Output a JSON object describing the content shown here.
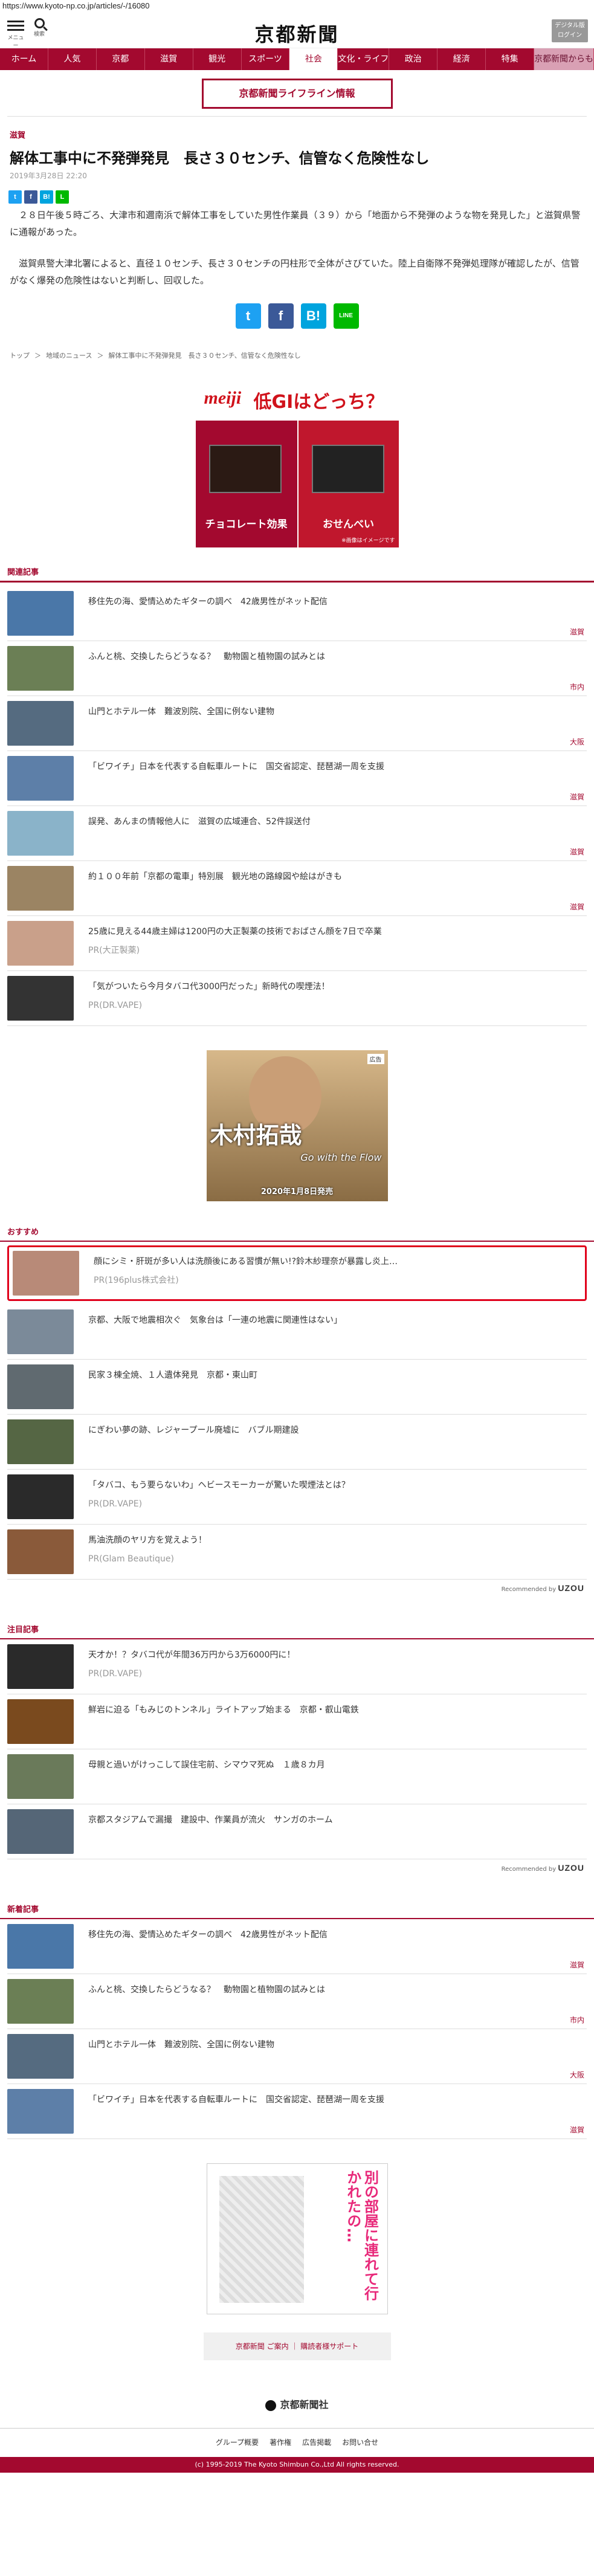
{
  "url": "https://www.kyoto-np.co.jp/articles/-/16080",
  "header": {
    "menu_label": "メニュー",
    "search_label": "検索",
    "logo": "京都新聞",
    "digital_line1": "デジタル版",
    "digital_line2": "ログイン"
  },
  "nav": [
    "ホーム",
    "人気",
    "京都",
    "滋賀",
    "観光",
    "スポーツ",
    "社会",
    "文化・ライフ",
    "政治",
    "経済",
    "特集",
    "京都新聞からも"
  ],
  "lifeline": "京都新聞ライフライン情報",
  "article": {
    "category": "滋賀",
    "title": "解体工事中に不発弾発見　長さ３０センチ、信管なく危険性なし",
    "date": "2019年3月28日 22:20",
    "paragraphs": [
      "２８日午後５時ごろ、大津市和邇南浜で解体工事をしていた男性作業員（３９）から「地面から不発弾のような物を発見した」と滋賀県警に通報があった。",
      "滋賀県警大津北署によると、直径１０センチ、長さ３０センチの円柱形で全体がさびていた。陸上自衛隊不発弾処理隊が確認したが、信管がなく爆発の危険性はないと判断し、回収した。"
    ]
  },
  "share": {
    "twitter": "t",
    "facebook": "f",
    "hatena": "B!",
    "line": "LINE"
  },
  "breadcrumb": [
    "トップ",
    "地域のニュース",
    "解体工事中に不発弾発見　長さ３０センチ、信管なく危険性なし"
  ],
  "ad1": {
    "brand": "meiji",
    "headline": "低GIはどっち？",
    "left_caption": "チョコレート効果",
    "right_caption": "おせんべい",
    "note": "※画像はイメージです"
  },
  "related": {
    "heading": "関連記事",
    "items": [
      {
        "title": "移住先の海、愛情込めたギターの調べ　42歳男性がネット配信",
        "tag": "滋賀",
        "color": "#4a77a8"
      },
      {
        "title": "ふんと桃、交換したらどうなる？　動物園と植物園の試みとは",
        "tag": "市内",
        "color": "#6b7f55"
      },
      {
        "title": "山門とホテル一体　難波別院、全国に例ない建物",
        "tag": "大阪",
        "color": "#556b80"
      },
      {
        "title": "「ビワイチ」日本を代表する自転車ルートに　国交省認定、琵琶湖一周を支援",
        "tag": "滋賀",
        "color": "#5d7fa8"
      },
      {
        "title": "誤発、あんまの情報他人に　滋賀の広域連合、52件誤送付",
        "tag": "滋賀",
        "color": "#8ab3c9"
      },
      {
        "title": "約１００年前「京都の電車」特別展　観光地の路線図や絵はがきも",
        "tag": "滋賀",
        "color": "#9b8463"
      },
      {
        "title": "25歳に見える44歳主婦は1200円の大正製薬の技術でおばさん顔を7日で卒業",
        "pr": "PR(大正製薬)",
        "color": "#c9a08a"
      },
      {
        "title": "「気がついたら今月タバコ代3000円だった」新時代の喫煙法！",
        "pr": "PR(DR.VAPE)",
        "color": "#333333"
      }
    ]
  },
  "ad2": {
    "badge": "広告",
    "name": "木村拓哉",
    "album": "Go with the Flow",
    "release": "2020年1月8日発売"
  },
  "recommend": {
    "heading": "おすすめ",
    "items": [
      {
        "title": "顔にシミ・肝斑が多い人は洗顔後にある習慣が無い!?鈴木紗理奈が暴露し炎上…",
        "pr": "PR(196plus株式会社)",
        "color": "#b88a78",
        "highlight": true
      },
      {
        "title": "京都、大阪で地震相次ぐ　気象台は「一連の地震に関連性はない」",
        "color": "#7b8a99"
      },
      {
        "title": "民家３棟全焼、１人遺体発見　京都・東山町",
        "color": "#606a70"
      },
      {
        "title": "にぎわい夢の跡、レジャープール廃墟に　バブル期建設",
        "color": "#556644"
      },
      {
        "title": "「タバコ、もう要らないわ」ヘビースモーカーが驚いた喫煙法とは？",
        "pr": "PR(DR.VAPE)",
        "color": "#2a2a2a"
      },
      {
        "title": "馬油洗顔のヤリ方を覚えよう！",
        "pr": "PR(Glam Beautique)",
        "color": "#8a5a3a"
      }
    ],
    "recommended_by": "Recommended by",
    "brand": "UZOU"
  },
  "attention": {
    "heading": "注目記事",
    "items": [
      {
        "title": "天才か！？タバコ代が年間36万円から3万6000円に！",
        "pr": "PR(DR.VAPE)",
        "color": "#2a2a2a"
      },
      {
        "title": "鮮岩に迫る「もみじのトンネル」ライトアップ始まる　京都・叡山電鉄",
        "color": "#7a4a1e"
      },
      {
        "title": "母親と過いがけっこして誤住宅前、シマウマ死ぬ　１歳８カ月",
        "color": "#6a7a5a"
      },
      {
        "title": "京都スタジアムで漏撮　建設中、作業員が流火　サンガのホーム",
        "color": "#556677"
      }
    ],
    "recommended_by": "Recommended by",
    "brand": "UZOU"
  },
  "latest": {
    "heading": "新着記事",
    "items": [
      {
        "title": "移住先の海、愛情込めたギターの調べ　42歳男性がネット配信",
        "tag": "滋賀",
        "color": "#4a77a8"
      },
      {
        "title": "ふんと桃、交換したらどうなる？　動物園と植物園の試みとは",
        "tag": "市内",
        "color": "#6b7f55"
      },
      {
        "title": "山門とホテル一体　難波別院、全国に例ない建物",
        "tag": "大阪",
        "color": "#556b80"
      },
      {
        "title": "「ビワイチ」日本を代表する自転車ルートに　国交省認定、琵琶湖一周を支援",
        "tag": "滋賀",
        "color": "#5d7fa8"
      }
    ]
  },
  "manga_ad": {
    "text": "別の部屋に連れて行かれたの…"
  },
  "foot_links": "京都新聞 ご案内 ｜ 購読者様サポート",
  "footer": {
    "company": "京都新聞社",
    "nav": [
      "グループ概要",
      "著作権",
      "広告掲載",
      "お問い合せ"
    ],
    "copyright": "(c) 1995-2019 The Kyoto Shimbun Co.,Ltd All rights reserved."
  }
}
